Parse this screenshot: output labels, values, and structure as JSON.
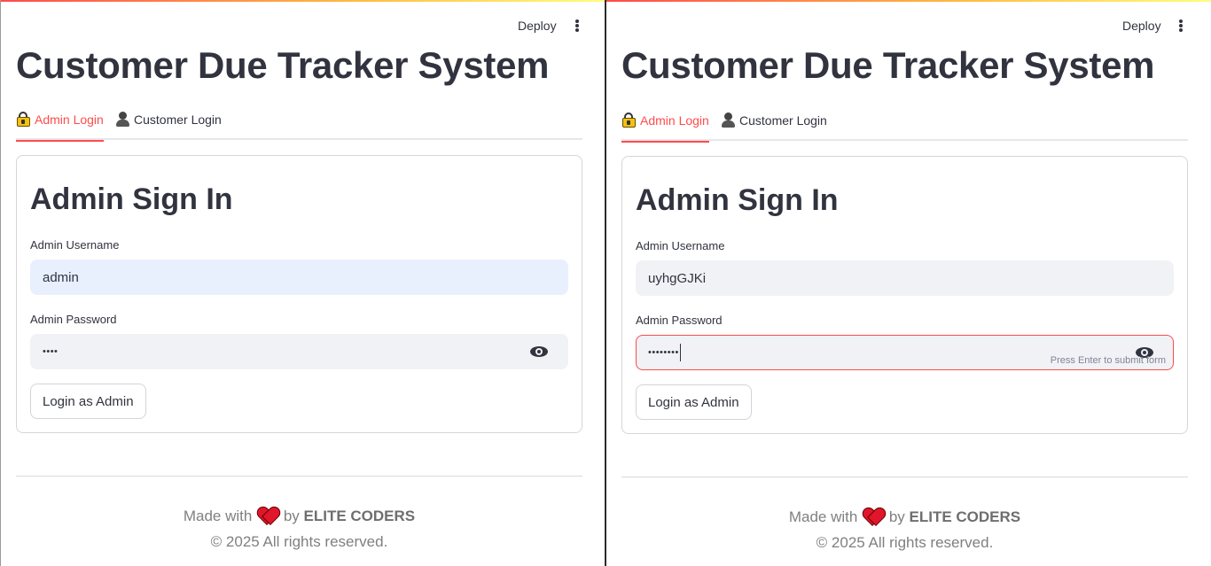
{
  "app": {
    "deploy_label": "Deploy",
    "title": "Customer Due Tracker System"
  },
  "tabs": [
    {
      "label": "Admin Login",
      "icon": "lock-key-icon",
      "active": true
    },
    {
      "label": "Customer Login",
      "icon": "person-icon",
      "active": false
    }
  ],
  "panes": [
    {
      "card": {
        "heading": "Admin Sign In",
        "username_label": "Admin Username",
        "username_value": "admin",
        "password_label": "Admin Password",
        "password_mask": "••••",
        "login_button": "Login as Admin"
      }
    },
    {
      "card": {
        "heading": "Admin Sign In",
        "username_label": "Admin Username",
        "username_value": "uyhgGJKi",
        "password_label": "Admin Password",
        "password_mask": "••••••••",
        "password_hint": "Press Enter to submit form",
        "login_button": "Login as Admin"
      }
    }
  ],
  "footer": {
    "made_with": "Made with",
    "by": "by",
    "brand": "ELITE CODERS",
    "copyright": "© 2025 All rights reserved."
  },
  "colors": {
    "accent": "#ff4b4b",
    "text": "#31333f",
    "input_bg": "#f0f2f6",
    "autofill_bg": "#e8f0fe"
  }
}
